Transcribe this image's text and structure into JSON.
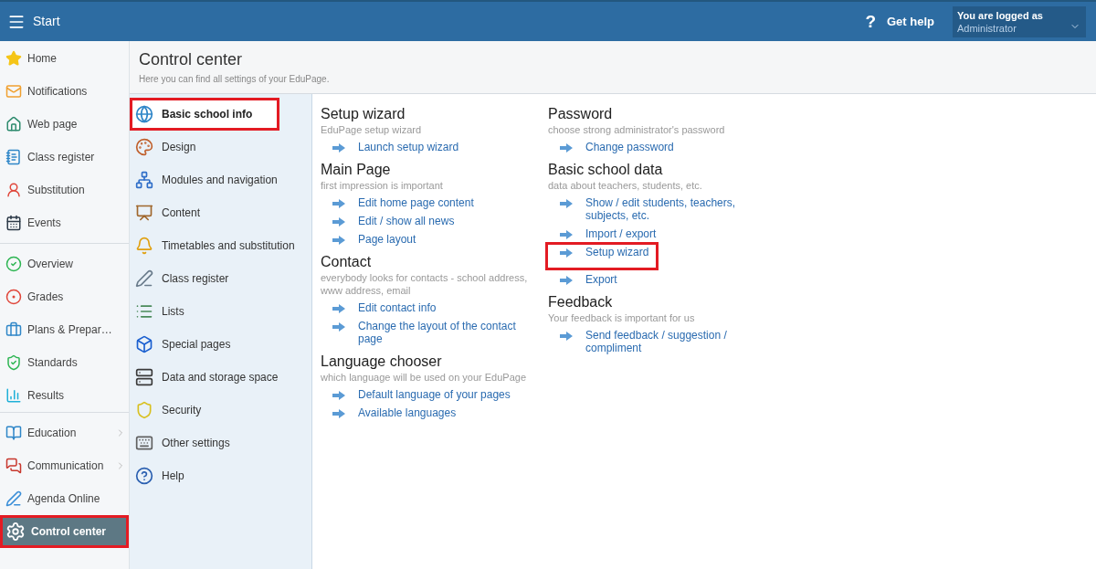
{
  "header": {
    "menu_label": "Start",
    "help_icon": "?",
    "help_label": "Get help",
    "user_caption": "You are logged as",
    "user_name": "Administrator"
  },
  "sidebar": {
    "groups": [
      [
        {
          "label": "Home",
          "selected": false,
          "expandable": false,
          "highlighted": false
        },
        {
          "label": "Notifications",
          "selected": false,
          "expandable": false,
          "highlighted": false
        },
        {
          "label": "Web page",
          "selected": false,
          "expandable": false,
          "highlighted": false
        },
        {
          "label": "Class register",
          "selected": false,
          "expandable": false,
          "highlighted": false
        },
        {
          "label": "Substitution",
          "selected": false,
          "expandable": false,
          "highlighted": false
        },
        {
          "label": "Events",
          "selected": false,
          "expandable": false,
          "highlighted": false
        }
      ],
      [
        {
          "label": "Overview",
          "selected": false,
          "expandable": false,
          "highlighted": false
        },
        {
          "label": "Grades",
          "selected": false,
          "expandable": false,
          "highlighted": false
        },
        {
          "label": "Plans & Prepar…",
          "selected": false,
          "expandable": false,
          "highlighted": false
        },
        {
          "label": "Standards",
          "selected": false,
          "expandable": false,
          "highlighted": false
        },
        {
          "label": "Results",
          "selected": false,
          "expandable": false,
          "highlighted": false
        }
      ],
      [
        {
          "label": "Education",
          "selected": false,
          "expandable": true,
          "highlighted": false
        },
        {
          "label": "Communication",
          "selected": false,
          "expandable": true,
          "highlighted": false
        },
        {
          "label": "Agenda Online",
          "selected": false,
          "expandable": false,
          "highlighted": false
        },
        {
          "label": "Control center",
          "selected": true,
          "expandable": false,
          "highlighted": true
        }
      ]
    ]
  },
  "page": {
    "title": "Control center",
    "subtitle": "Here you can find all settings of your EduPage."
  },
  "categories": [
    {
      "label": "Basic school info",
      "selected": true,
      "highlighted": true
    },
    {
      "label": "Design",
      "selected": false,
      "highlighted": false
    },
    {
      "label": "Modules and navigation",
      "selected": false,
      "highlighted": false
    },
    {
      "label": "Content",
      "selected": false,
      "highlighted": false
    },
    {
      "label": "Timetables and substitution",
      "selected": false,
      "highlighted": false
    },
    {
      "label": "Class register",
      "selected": false,
      "highlighted": false
    },
    {
      "label": "Lists",
      "selected": false,
      "highlighted": false
    },
    {
      "label": "Special pages",
      "selected": false,
      "highlighted": false
    },
    {
      "label": "Data and storage space",
      "selected": false,
      "highlighted": false
    },
    {
      "label": "Security",
      "selected": false,
      "highlighted": false
    },
    {
      "label": "Other settings",
      "selected": false,
      "highlighted": false
    },
    {
      "label": "Help",
      "selected": false,
      "highlighted": false
    }
  ],
  "columns": [
    [
      {
        "title": "Setup wizard",
        "description": "EduPage setup wizard",
        "links": [
          {
            "label": "Launch setup wizard",
            "highlighted": false
          }
        ]
      },
      {
        "title": "Main Page",
        "description": "first impression is important",
        "links": [
          {
            "label": "Edit home page content",
            "highlighted": false
          },
          {
            "label": "Edit / show all news",
            "highlighted": false
          },
          {
            "label": "Page layout",
            "highlighted": false
          }
        ]
      },
      {
        "title": "Contact",
        "description": "everybody looks for contacts - school address, www address, email",
        "links": [
          {
            "label": "Edit contact info",
            "highlighted": false
          },
          {
            "label": "Change the layout of the contact page",
            "highlighted": false
          }
        ]
      },
      {
        "title": "Language chooser",
        "description": "which language will be used on your EduPage",
        "links": [
          {
            "label": "Default language of your pages",
            "highlighted": false
          },
          {
            "label": "Available languages",
            "highlighted": false
          }
        ]
      }
    ],
    [
      {
        "title": "Password",
        "description": "choose strong administrator's password",
        "links": [
          {
            "label": "Change password",
            "highlighted": false
          }
        ]
      },
      {
        "title": "Basic school data",
        "description": "data about teachers, students, etc.",
        "links": [
          {
            "label": "Show / edit students, teachers, subjects, etc.",
            "highlighted": false
          },
          {
            "label": "Import / export",
            "highlighted": false
          },
          {
            "label": "Setup wizard",
            "highlighted": true
          },
          {
            "label": "Export",
            "highlighted": false
          }
        ]
      },
      {
        "title": "Feedback",
        "description": "Your feedback is important for us",
        "links": [
          {
            "label": "Send feedback / suggestion / compliment",
            "highlighted": false
          }
        ]
      }
    ]
  ]
}
